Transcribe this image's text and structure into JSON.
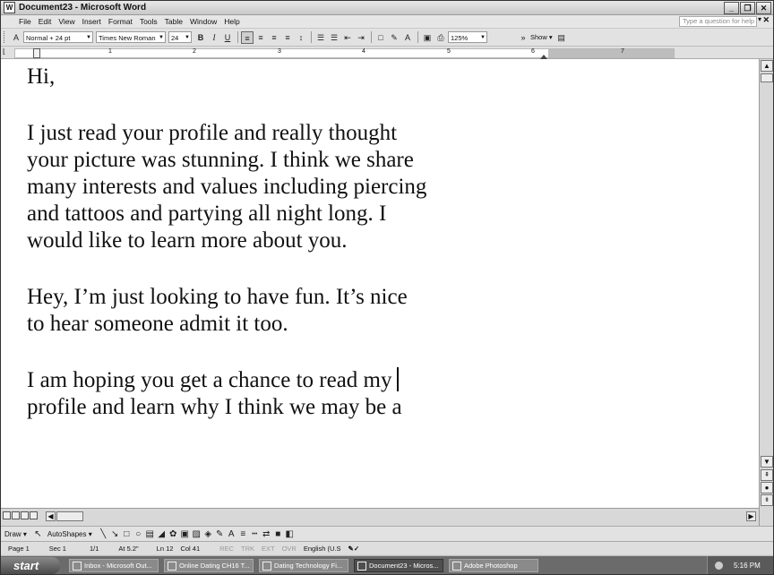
{
  "window": {
    "title": "Document23 - Microsoft Word",
    "buttons": [
      "_",
      "❐",
      "✕"
    ]
  },
  "menubar": {
    "items": [
      "File",
      "Edit",
      "View",
      "Insert",
      "Format",
      "Tools",
      "Table",
      "Window",
      "Help"
    ],
    "help_placeholder": "Type a question for help",
    "close_doc": "✕"
  },
  "toolbar": {
    "style": "Normal + 24 pt",
    "font": "Times New Roman",
    "size": "24",
    "bold": "B",
    "italic": "I",
    "underline": "U",
    "zoom": "125%",
    "show": "Show ▾"
  },
  "ruler": {
    "numbers": [
      "1",
      "2",
      "3",
      "4",
      "5",
      "6",
      "7"
    ]
  },
  "document": {
    "line1": "Hi,",
    "para1": [
      "I just read your profile and really thought",
      "your picture was stunning. I think we share",
      "many interests and values including piercing",
      "and tattoos and partying all night long. I",
      "would like to learn more about you."
    ],
    "para2": [
      "Hey, I’m just looking to have fun. It’s nice",
      "to hear someone admit it too."
    ],
    "para3": [
      "I am hoping you get a chance to read my",
      "profile and learn why I think we may be a"
    ]
  },
  "drawbar": {
    "draw": "Draw ▾",
    "autoshapes": "AutoShapes ▾"
  },
  "status": {
    "page": "Page 1",
    "sec": "Sec 1",
    "pages": "1/1",
    "at": "At 5.2\"",
    "ln": "Ln 12",
    "col": "Col 41",
    "rec": "REC",
    "trk": "TRK",
    "ext": "EXT",
    "ovr": "OVR",
    "lang": "English (U.S"
  },
  "taskbar": {
    "start": "start",
    "items": [
      "Inbox - Microsoft Out...",
      "Online Dating CH16 T...",
      "Dating Technology Fi...",
      "Document23 - Micros...",
      "Adobe Photoshop"
    ],
    "time": "5:16 PM"
  }
}
